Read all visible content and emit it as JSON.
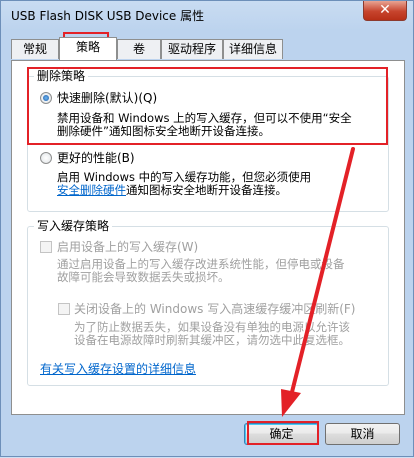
{
  "window": {
    "title": "USB Flash DISK USB Device 属性",
    "close_glyph": "✕"
  },
  "tabs": [
    {
      "label": "常规"
    },
    {
      "label": "策略"
    },
    {
      "label": "卷"
    },
    {
      "label": "驱动程序"
    },
    {
      "label": "详细信息"
    }
  ],
  "removal_policy": {
    "title": "删除策略",
    "quick_removal": {
      "label": "快速删除(默认)(Q)",
      "desc_line1": "禁用设备和 Windows 上的写入缓存，但可以不使用“安全",
      "desc_line2": "删除硬件”通知图标安全地断开设备连接。",
      "checked": true
    },
    "better_performance": {
      "label": "更好的性能(B)",
      "desc_line1": "启用 Windows 中的写入缓存功能，但您必须使用",
      "link": "安全删除硬件",
      "desc_line2_rest": "通知图标安全地断开设备连接。",
      "checked": false
    }
  },
  "write_cache_policy": {
    "title": "写入缓存策略",
    "enable_write_cache": {
      "label": "启用设备上的写入缓存(W)",
      "desc_line1": "通过启用设备上的写入缓存改进系统性能，但停电或设备",
      "desc_line2": "故障可能会导致数据丢失或损坏。",
      "checked": false
    },
    "disable_flush": {
      "label": "关闭设备上的 Windows 写入高速缓存缓冲区刷新(F)",
      "desc_line1": "为了防止数据丢失，如果设备没有单独的电源以允许该",
      "desc_line2": "设备在电源故障时刷新其缓冲区，请勿选中此复选框。",
      "checked": false
    }
  },
  "more_info_link": "有关写入缓存设置的详细信息",
  "buttons": {
    "ok": "确定",
    "cancel": "取消"
  },
  "colors": {
    "highlight": "#e32127",
    "link": "#0066cc",
    "disabled_text": "#a0a0a0"
  }
}
